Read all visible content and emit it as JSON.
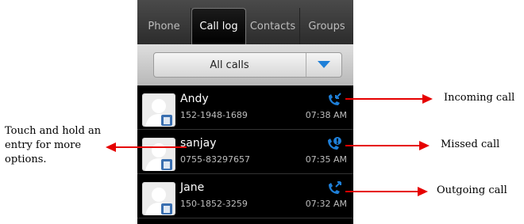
{
  "tabs": [
    {
      "label": "Phone",
      "active": false
    },
    {
      "label": "Call log",
      "active": true
    },
    {
      "label": "Contacts",
      "active": false
    },
    {
      "label": "Groups",
      "active": false
    }
  ],
  "filter": {
    "value": "All calls",
    "icon": "dropdown-triangle-icon"
  },
  "calls": [
    {
      "name": "Andy",
      "number": "152-1948-1689",
      "time": "07:38 AM",
      "call_type_icon": "incoming-call-icon"
    },
    {
      "name": "sanjay",
      "number": "0755-83297657",
      "time": "07:35 AM",
      "call_type_icon": "missed-call-icon"
    },
    {
      "name": "Jane",
      "number": "150-1852-3259",
      "time": "07:32 AM",
      "call_type_icon": "outgoing-call-icon"
    }
  ],
  "annotations": {
    "left_note": [
      "Touch and hold an",
      "entry for more",
      "options."
    ],
    "incoming": "Incoming call",
    "missed": "Missed call",
    "outgoing": "Outgoing call"
  },
  "colors": {
    "accent_blue": "#1e7fd8",
    "arrow_red": "#e60000"
  }
}
